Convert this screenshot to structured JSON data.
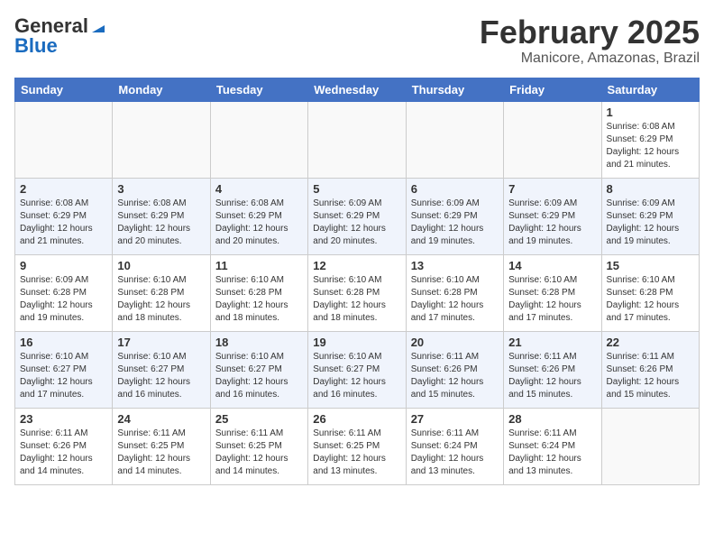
{
  "header": {
    "logo_general": "General",
    "logo_blue": "Blue",
    "main_title": "February 2025",
    "subtitle": "Manicore, Amazonas, Brazil"
  },
  "weekdays": [
    "Sunday",
    "Monday",
    "Tuesday",
    "Wednesday",
    "Thursday",
    "Friday",
    "Saturday"
  ],
  "weeks": [
    [
      {
        "day": "",
        "info": ""
      },
      {
        "day": "",
        "info": ""
      },
      {
        "day": "",
        "info": ""
      },
      {
        "day": "",
        "info": ""
      },
      {
        "day": "",
        "info": ""
      },
      {
        "day": "",
        "info": ""
      },
      {
        "day": "1",
        "info": "Sunrise: 6:08 AM\nSunset: 6:29 PM\nDaylight: 12 hours and 21 minutes."
      }
    ],
    [
      {
        "day": "2",
        "info": "Sunrise: 6:08 AM\nSunset: 6:29 PM\nDaylight: 12 hours and 21 minutes."
      },
      {
        "day": "3",
        "info": "Sunrise: 6:08 AM\nSunset: 6:29 PM\nDaylight: 12 hours and 20 minutes."
      },
      {
        "day": "4",
        "info": "Sunrise: 6:08 AM\nSunset: 6:29 PM\nDaylight: 12 hours and 20 minutes."
      },
      {
        "day": "5",
        "info": "Sunrise: 6:09 AM\nSunset: 6:29 PM\nDaylight: 12 hours and 20 minutes."
      },
      {
        "day": "6",
        "info": "Sunrise: 6:09 AM\nSunset: 6:29 PM\nDaylight: 12 hours and 19 minutes."
      },
      {
        "day": "7",
        "info": "Sunrise: 6:09 AM\nSunset: 6:29 PM\nDaylight: 12 hours and 19 minutes."
      },
      {
        "day": "8",
        "info": "Sunrise: 6:09 AM\nSunset: 6:29 PM\nDaylight: 12 hours and 19 minutes."
      }
    ],
    [
      {
        "day": "9",
        "info": "Sunrise: 6:09 AM\nSunset: 6:28 PM\nDaylight: 12 hours and 19 minutes."
      },
      {
        "day": "10",
        "info": "Sunrise: 6:10 AM\nSunset: 6:28 PM\nDaylight: 12 hours and 18 minutes."
      },
      {
        "day": "11",
        "info": "Sunrise: 6:10 AM\nSunset: 6:28 PM\nDaylight: 12 hours and 18 minutes."
      },
      {
        "day": "12",
        "info": "Sunrise: 6:10 AM\nSunset: 6:28 PM\nDaylight: 12 hours and 18 minutes."
      },
      {
        "day": "13",
        "info": "Sunrise: 6:10 AM\nSunset: 6:28 PM\nDaylight: 12 hours and 17 minutes."
      },
      {
        "day": "14",
        "info": "Sunrise: 6:10 AM\nSunset: 6:28 PM\nDaylight: 12 hours and 17 minutes."
      },
      {
        "day": "15",
        "info": "Sunrise: 6:10 AM\nSunset: 6:28 PM\nDaylight: 12 hours and 17 minutes."
      }
    ],
    [
      {
        "day": "16",
        "info": "Sunrise: 6:10 AM\nSunset: 6:27 PM\nDaylight: 12 hours and 17 minutes."
      },
      {
        "day": "17",
        "info": "Sunrise: 6:10 AM\nSunset: 6:27 PM\nDaylight: 12 hours and 16 minutes."
      },
      {
        "day": "18",
        "info": "Sunrise: 6:10 AM\nSunset: 6:27 PM\nDaylight: 12 hours and 16 minutes."
      },
      {
        "day": "19",
        "info": "Sunrise: 6:10 AM\nSunset: 6:27 PM\nDaylight: 12 hours and 16 minutes."
      },
      {
        "day": "20",
        "info": "Sunrise: 6:11 AM\nSunset: 6:26 PM\nDaylight: 12 hours and 15 minutes."
      },
      {
        "day": "21",
        "info": "Sunrise: 6:11 AM\nSunset: 6:26 PM\nDaylight: 12 hours and 15 minutes."
      },
      {
        "day": "22",
        "info": "Sunrise: 6:11 AM\nSunset: 6:26 PM\nDaylight: 12 hours and 15 minutes."
      }
    ],
    [
      {
        "day": "23",
        "info": "Sunrise: 6:11 AM\nSunset: 6:26 PM\nDaylight: 12 hours and 14 minutes."
      },
      {
        "day": "24",
        "info": "Sunrise: 6:11 AM\nSunset: 6:25 PM\nDaylight: 12 hours and 14 minutes."
      },
      {
        "day": "25",
        "info": "Sunrise: 6:11 AM\nSunset: 6:25 PM\nDaylight: 12 hours and 14 minutes."
      },
      {
        "day": "26",
        "info": "Sunrise: 6:11 AM\nSunset: 6:25 PM\nDaylight: 12 hours and 13 minutes."
      },
      {
        "day": "27",
        "info": "Sunrise: 6:11 AM\nSunset: 6:24 PM\nDaylight: 12 hours and 13 minutes."
      },
      {
        "day": "28",
        "info": "Sunrise: 6:11 AM\nSunset: 6:24 PM\nDaylight: 12 hours and 13 minutes."
      },
      {
        "day": "",
        "info": ""
      }
    ]
  ]
}
